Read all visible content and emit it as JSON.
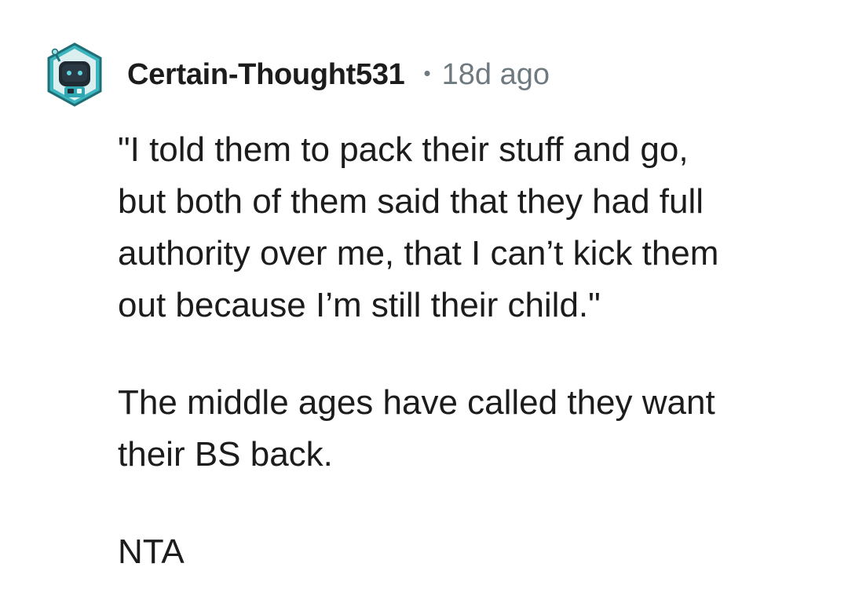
{
  "comment": {
    "author": "Certain-Thought531",
    "separator": "•",
    "age": "18d ago",
    "avatar_icon": "robot-avatar-icon",
    "paragraphs": [
      "\"I told them to pack their stuff and go,\nbut both of them said that they had full\nauthority over me, that I can’t kick them\nout because I’m still their child.\"",
      "The middle ages have called they want\ntheir BS back.",
      "NTA"
    ]
  },
  "colors": {
    "text": "#1c1c1c",
    "meta": "#6f7a80",
    "avatar_ring": "#2fa6b0",
    "avatar_dark": "#1f2a33"
  }
}
